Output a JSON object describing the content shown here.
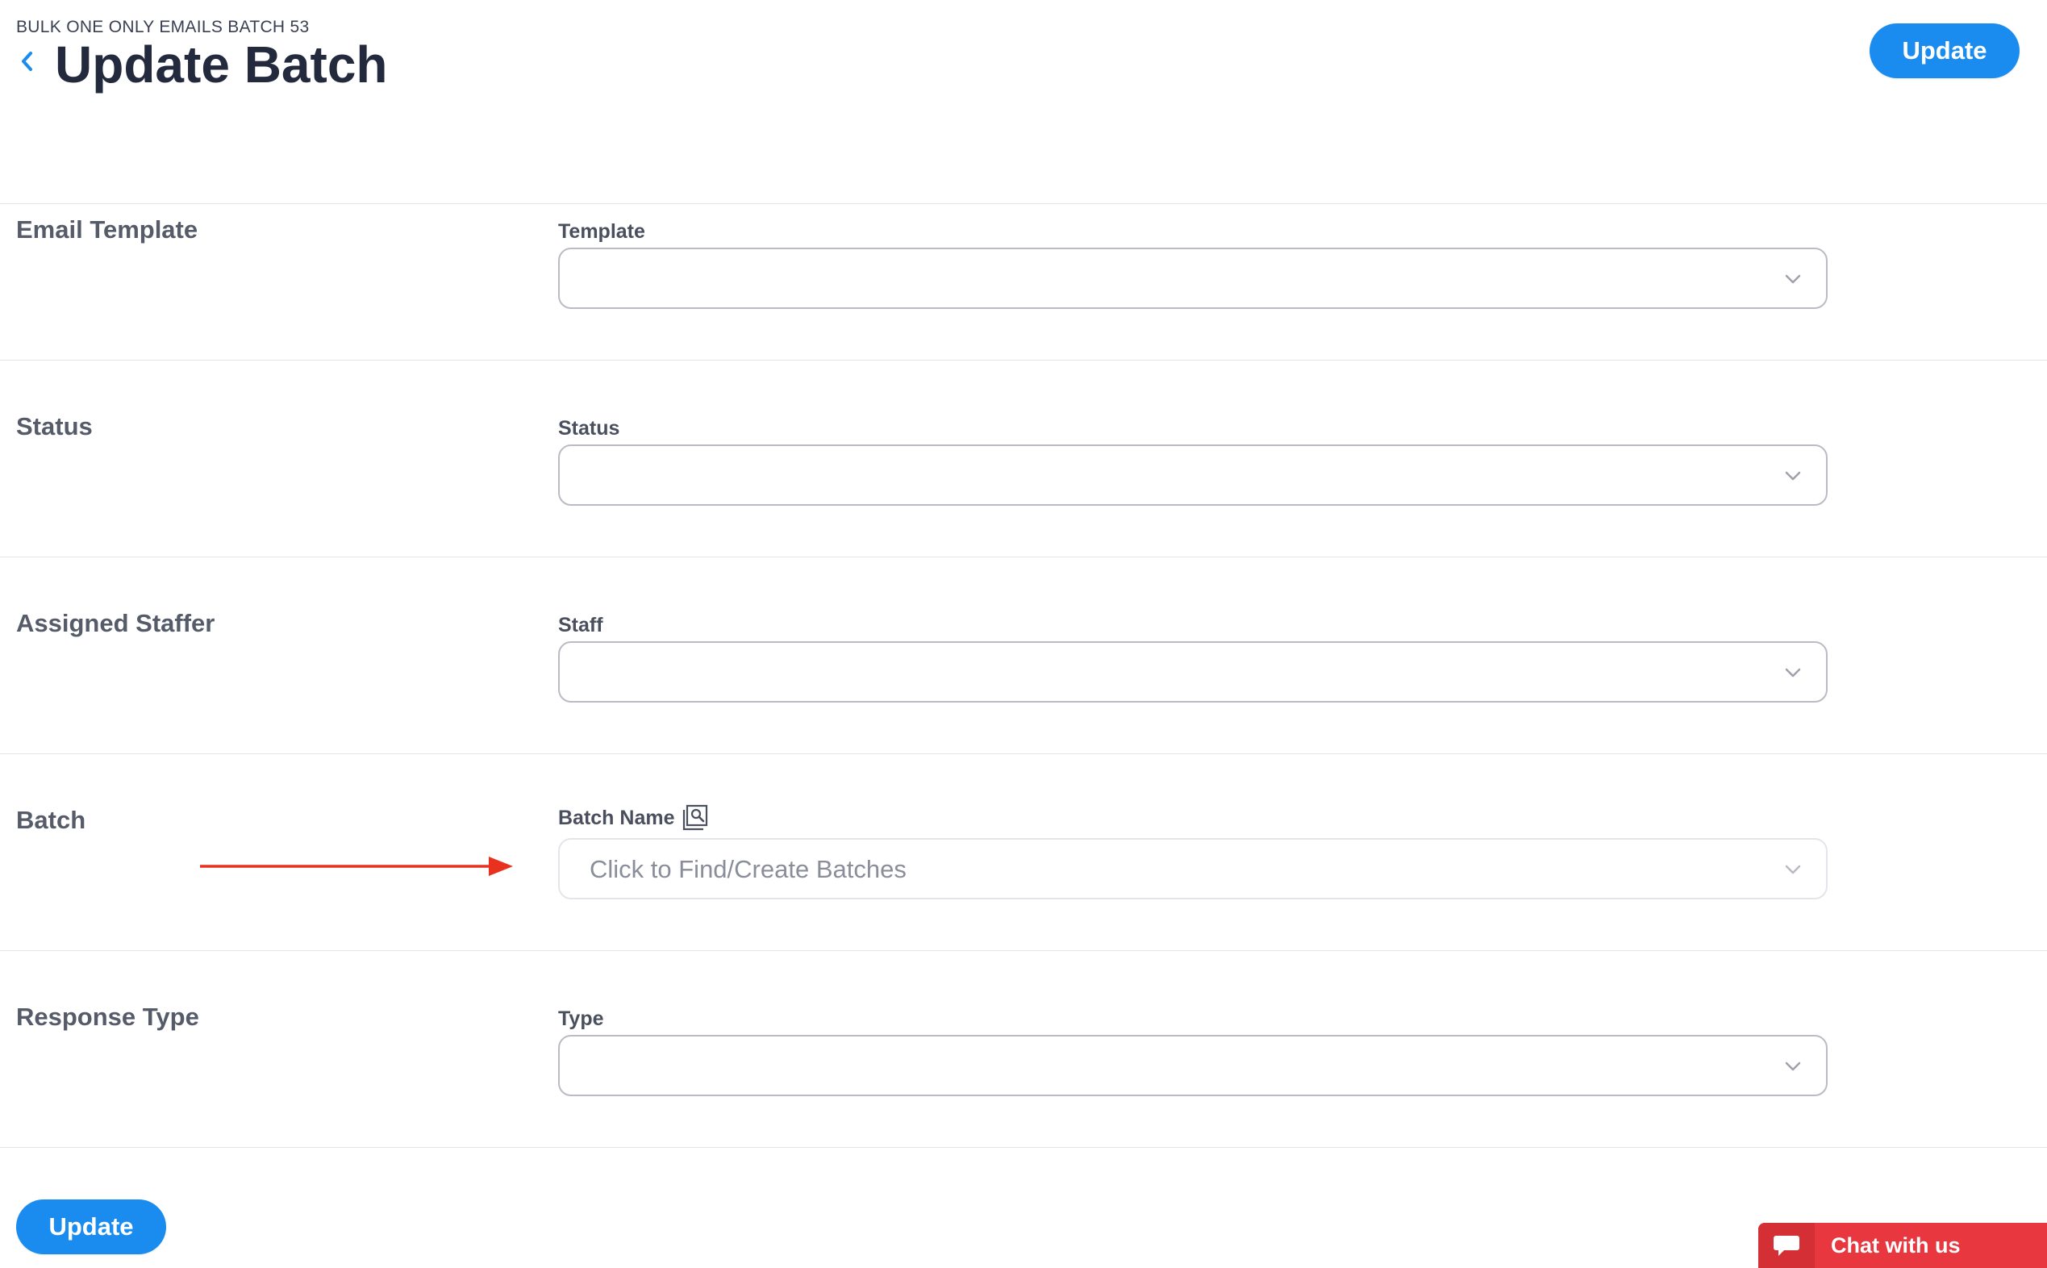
{
  "header": {
    "eyebrow": "BULK ONE ONLY EMAILS BATCH 53",
    "title": "Update Batch",
    "update_label": "Update"
  },
  "sections": [
    {
      "label": "Email Template",
      "field_label": "Template",
      "value": ""
    },
    {
      "label": "Status",
      "field_label": "Status",
      "value": ""
    },
    {
      "label": "Assigned Staffer",
      "field_label": "Staff",
      "value": ""
    },
    {
      "label": "Batch",
      "field_label": "Batch Name",
      "placeholder": "Click to Find/Create Batches"
    },
    {
      "label": "Response Type",
      "field_label": "Type",
      "value": ""
    }
  ],
  "footer": {
    "update_label": "Update"
  },
  "chat": {
    "label": "Chat with us"
  },
  "colors": {
    "accent": "#1a8cf0",
    "annotation_arrow": "#e8311f",
    "chat_bg": "#e8373e"
  },
  "icons": {
    "back": "chevron-left-icon",
    "dropdown": "chevron-down-icon",
    "lookup": "search-document-icon",
    "chat": "chat-bubble-icon"
  }
}
